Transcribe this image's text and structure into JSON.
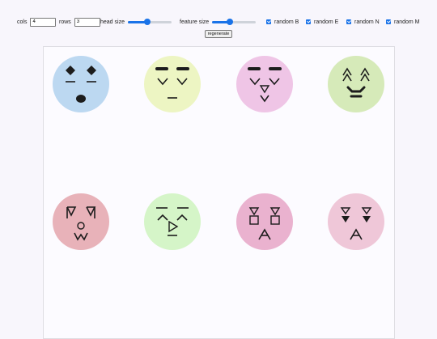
{
  "controls": {
    "cols_label": "cols",
    "cols_value": "4",
    "rows_label": "rows",
    "rows_value": "3",
    "head_size_label": "head size",
    "feature_size_label": "feature size",
    "random_b_label": "random B",
    "random_e_label": "random E",
    "random_n_label": "random N",
    "random_m_label": "random M",
    "regenerate_label": "regenerate"
  },
  "slider_levels": {
    "head_size": 0.45,
    "feature_size": 0.4
  },
  "checkboxes": {
    "random_b": true,
    "random_e": true,
    "random_n": true,
    "random_m": true
  },
  "faces": [
    {
      "color": "#bcd8f1",
      "brows": "diamond",
      "eyes": "dash",
      "nose": "none",
      "mouth": "blob"
    },
    {
      "color": "#edf5c3",
      "brows": "bar",
      "eyes": "v",
      "nose": "none",
      "mouth": "line"
    },
    {
      "color": "#efc5e6",
      "brows": "bar",
      "eyes": "v",
      "nose": "tri-down",
      "mouth": "v"
    },
    {
      "color": "#d6eab9",
      "brows": "chevron-stack",
      "eyes": "none",
      "nose": "none",
      "mouth": "smile-bar"
    },
    {
      "color": "#e8b2b9",
      "brows": "none",
      "eyes": "y-shape",
      "nose": "circle",
      "mouth": "w"
    },
    {
      "color": "#d5f5c8",
      "brows": "line",
      "eyes": "chevron-up",
      "nose": "play",
      "mouth": "line"
    },
    {
      "color": "#eab2cf",
      "brows": "none",
      "eyes": "tri-square",
      "nose": "none",
      "mouth": "a-shape"
    },
    {
      "color": "#efc7d8",
      "brows": "none",
      "eyes": "tri-filled",
      "nose": "none",
      "mouth": "a-shape"
    }
  ]
}
